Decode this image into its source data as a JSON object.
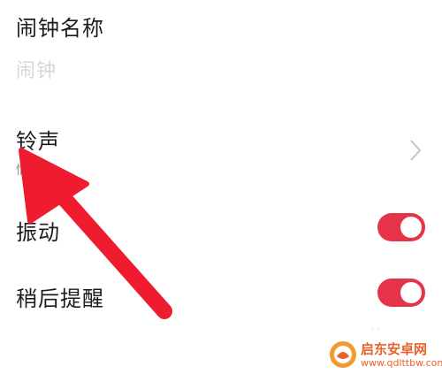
{
  "alarm_name": {
    "label": "闹钟名称",
    "placeholder": "闹钟"
  },
  "ringtone": {
    "label": "铃声",
    "subtitle": "情"
  },
  "vibration": {
    "label": "振动",
    "enabled": true
  },
  "snooze": {
    "label": "稍后提醒",
    "enabled": true
  },
  "colors": {
    "toggle_on": "#e5344a",
    "annotation_arrow": "#ee1c2e",
    "watermark": "#e8632b"
  },
  "watermark": {
    "title": "启东安卓网",
    "url": "www.qdlttbw.com"
  }
}
